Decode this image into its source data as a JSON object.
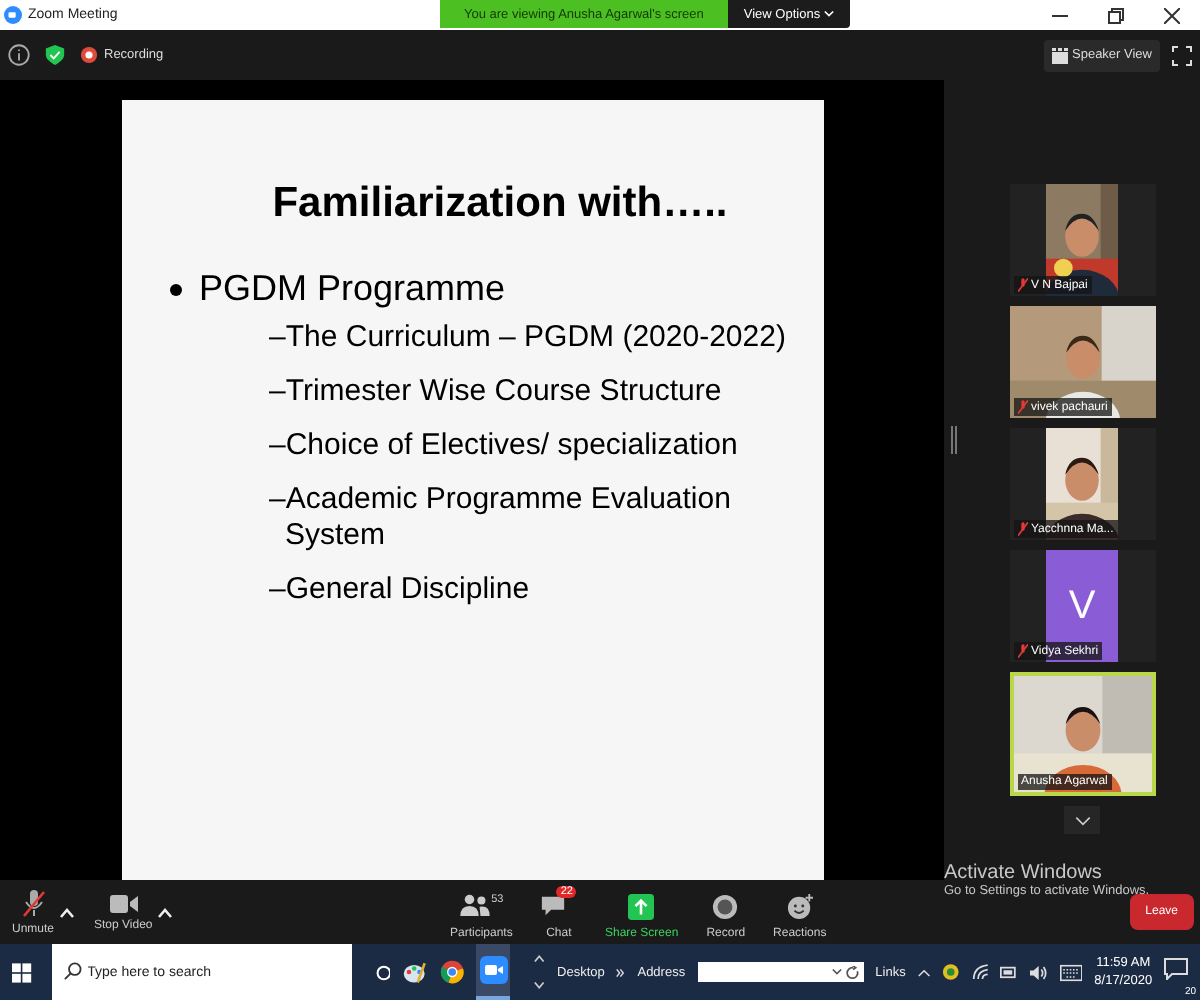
{
  "window": {
    "title": "Zoom Meeting"
  },
  "share_banner": {
    "text": "You are viewing Anusha Agarwal's screen",
    "view_options": "View Options"
  },
  "top_bar": {
    "recording": "Recording",
    "speaker_view": "Speaker View"
  },
  "slide": {
    "title": "Familiarization with…..",
    "bullets": [
      {
        "text": "PGDM Programme",
        "children": [
          {
            "text": "–The Curriculum – PGDM (2020-2022)"
          },
          {
            "text": "–Trimester Wise Course Structure"
          },
          {
            "text": "–Choice of Electives/ specialization"
          },
          {
            "text": "–Academic Programme Evaluation System"
          },
          {
            "text": "–General Discipline"
          }
        ]
      }
    ]
  },
  "gallery": [
    {
      "name": "V N Bajpai",
      "kind": "picture",
      "muted": true,
      "speaking": false
    },
    {
      "name": "vivek pachauri",
      "kind": "picture",
      "muted": true,
      "speaking": false
    },
    {
      "name": "Yacchnna Ma...",
      "kind": "picture",
      "muted": true,
      "speaking": false
    },
    {
      "name": "Vidya Sekhri",
      "kind": "avatar",
      "letter": "V",
      "color": "#8a5cd6",
      "muted": true,
      "speaking": false
    },
    {
      "name": "Anusha Agarwal",
      "kind": "picture",
      "muted": false,
      "speaking": true
    }
  ],
  "toolbar": [
    {
      "label": "Unmute",
      "kind": "mic",
      "caret": true
    },
    {
      "label": "Stop Video",
      "kind": "video",
      "caret": true
    },
    {
      "label": "Participants",
      "kind": "participants",
      "count": "53"
    },
    {
      "label": "Chat",
      "kind": "chat",
      "badge": "22"
    },
    {
      "label": "Share Screen",
      "kind": "share"
    },
    {
      "label": "Record",
      "kind": "record"
    },
    {
      "label": "Reactions",
      "kind": "reactions"
    }
  ],
  "leave": "Leave",
  "activation": {
    "title": "Activate Windows",
    "text": "Go to Settings to activate Windows."
  },
  "taskbar": {
    "search_placeholder": "Type here to search",
    "desktop": "Desktop",
    "address": "Address",
    "links": "Links",
    "time": "11:59 AM",
    "date": "8/17/2020",
    "notifications": "20"
  }
}
